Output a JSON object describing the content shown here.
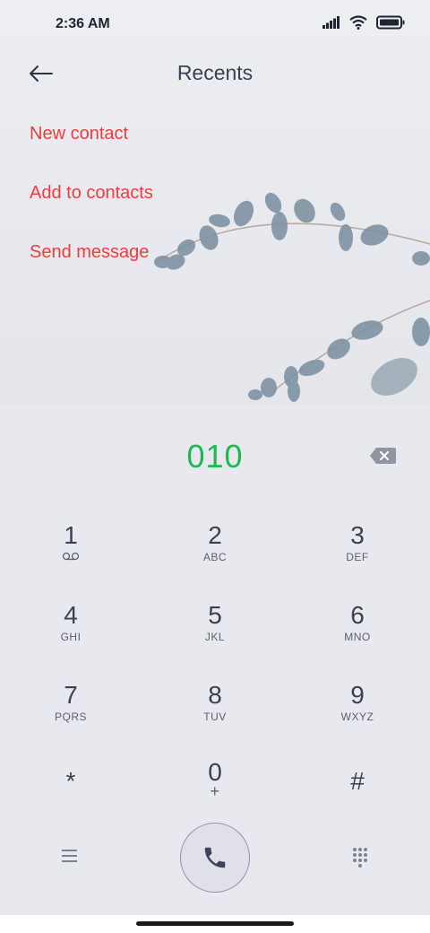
{
  "status_bar": {
    "time": "2:36 AM"
  },
  "header": {
    "title": "Recents"
  },
  "actions": {
    "new_contact": "New contact",
    "add_to_contacts": "Add to contacts",
    "send_message": "Send message"
  },
  "dialer": {
    "number": "010"
  },
  "keypad": {
    "keys": [
      {
        "digit": "1",
        "letters": ""
      },
      {
        "digit": "2",
        "letters": "ABC"
      },
      {
        "digit": "3",
        "letters": "DEF"
      },
      {
        "digit": "4",
        "letters": "GHI"
      },
      {
        "digit": "5",
        "letters": "JKL"
      },
      {
        "digit": "6",
        "letters": "MNO"
      },
      {
        "digit": "7",
        "letters": "PQRS"
      },
      {
        "digit": "8",
        "letters": "TUV"
      },
      {
        "digit": "9",
        "letters": "WXYZ"
      },
      {
        "digit": "*",
        "letters": ""
      },
      {
        "digit": "0",
        "letters": "+"
      },
      {
        "digit": "#",
        "letters": ""
      }
    ]
  },
  "icons": {
    "back": "back-arrow-icon",
    "backspace": "backspace-icon",
    "voicemail": "voicemail-icon",
    "menu": "menu-icon",
    "call": "phone-icon",
    "dialpad": "dialpad-icon"
  },
  "colors": {
    "accent_red": "#ef3b3b",
    "number_green": "#1fb84f",
    "call_button": "#dfe0e9"
  }
}
